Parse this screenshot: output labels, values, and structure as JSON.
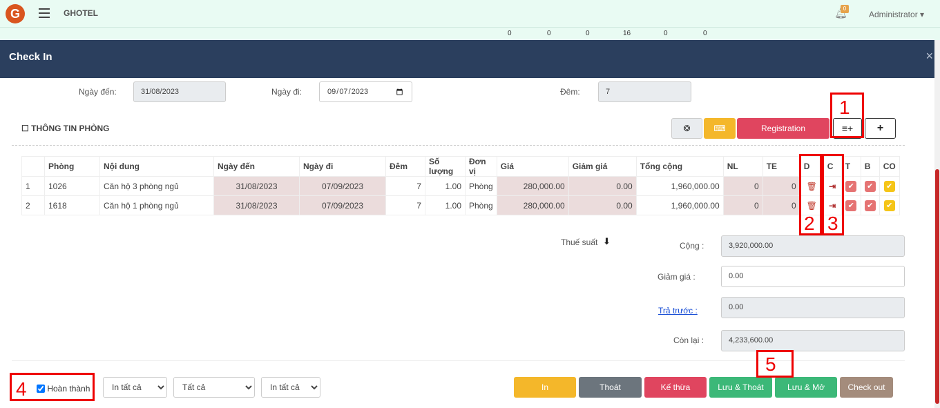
{
  "app": {
    "brand": "GHOTEL",
    "logo_letter": "G",
    "user": "Administrator ▾",
    "notification_count": "0"
  },
  "counters": [
    "0",
    "0",
    "0",
    "16",
    "0",
    "0"
  ],
  "modal": {
    "title": "Check In",
    "close": "×"
  },
  "dates": {
    "arrival_label": "Ngày đến:",
    "arrival_value": "31/08/2023",
    "departure_label": "Ngày đi:",
    "departure_value": "2023-09-07",
    "nights_label": "Đêm:",
    "nights_value": "7"
  },
  "section": {
    "title": "THÔNG TIN PHÒNG"
  },
  "toolbar": {
    "registration": "Registration",
    "add": "+"
  },
  "table": {
    "headers": [
      "",
      "Phòng",
      "Nội dung",
      "Ngày đến",
      "Ngày đi",
      "Đêm",
      "Số lượng",
      "Đơn vị",
      "Giá",
      "Giảm giá",
      "Tổng cộng",
      "NL",
      "TE",
      "D",
      "C",
      "T",
      "B",
      "CO"
    ],
    "rows": [
      {
        "idx": "1",
        "room": "1026",
        "desc": "Căn hộ 3 phòng ngủ",
        "from": "31/08/2023",
        "to": "07/09/2023",
        "nights": "7",
        "qty": "1.00",
        "unit": "Phòng",
        "price": "280,000.00",
        "discount": "0.00",
        "total": "1,960,000.00",
        "nl": "0",
        "te": "0"
      },
      {
        "idx": "2",
        "room": "1618",
        "desc": "Căn hộ 1 phòng ngủ",
        "from": "31/08/2023",
        "to": "07/09/2023",
        "nights": "7",
        "qty": "1.00",
        "unit": "Phòng",
        "price": "280,000.00",
        "discount": "0.00",
        "total": "1,960,000.00",
        "nl": "0",
        "te": "0"
      }
    ]
  },
  "summary": {
    "tax_label": "Thuế suất",
    "subtotal_label": "Cộng :",
    "subtotal_value": "3,920,000.00",
    "discount_label": "Giảm giá :",
    "discount_value": "0.00",
    "prepaid_label": "Trả trước :",
    "prepaid_value": "0.00",
    "remaining_label": "Còn lại :",
    "remaining_value": "4,233,600.00"
  },
  "footer": {
    "complete_label": "Hoàn thành",
    "select1": "In tất cả",
    "select2": "Tất cả",
    "select3": "In tất cả",
    "btn_print": "In",
    "btn_exit": "Thoát",
    "btn_inherit": "Kế thừa",
    "btn_save_exit": "Lưu & Thoát",
    "btn_save_open": "Lưu & Mở",
    "btn_checkout": "Check out"
  },
  "annotations": [
    "1",
    "2",
    "3",
    "4",
    "5"
  ],
  "colors": {
    "header_bg": "#2b3f5e",
    "registration": "#e0455f",
    "print": "#f4b72a",
    "exit": "#6c757d",
    "inherit": "#e0455f",
    "save": "#3cb878",
    "checkout": "#a48c7c",
    "annotation": "#ee0000"
  }
}
